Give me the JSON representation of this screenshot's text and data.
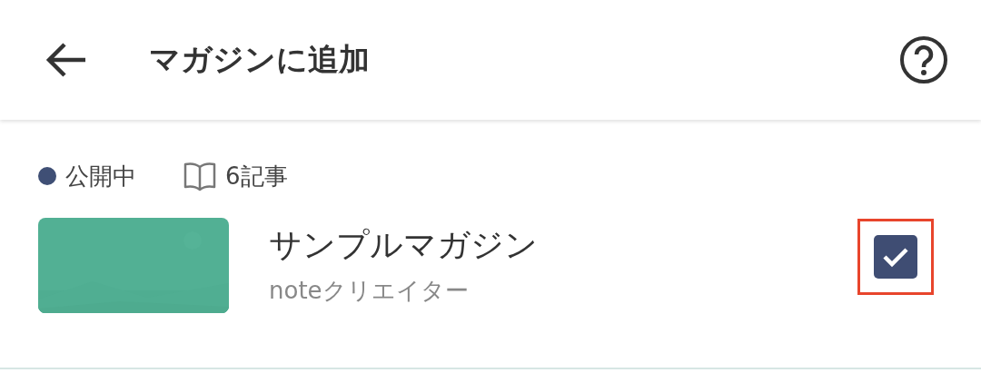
{
  "header": {
    "title": "マガジンに追加"
  },
  "status": {
    "label": "公開中",
    "color": "#3f4f75"
  },
  "article_count": "6記事",
  "magazine": {
    "kind": "picture",
    "title": "サンプルマガジン",
    "author": "noteクリエイター",
    "checked": true,
    "highlighted": true
  }
}
